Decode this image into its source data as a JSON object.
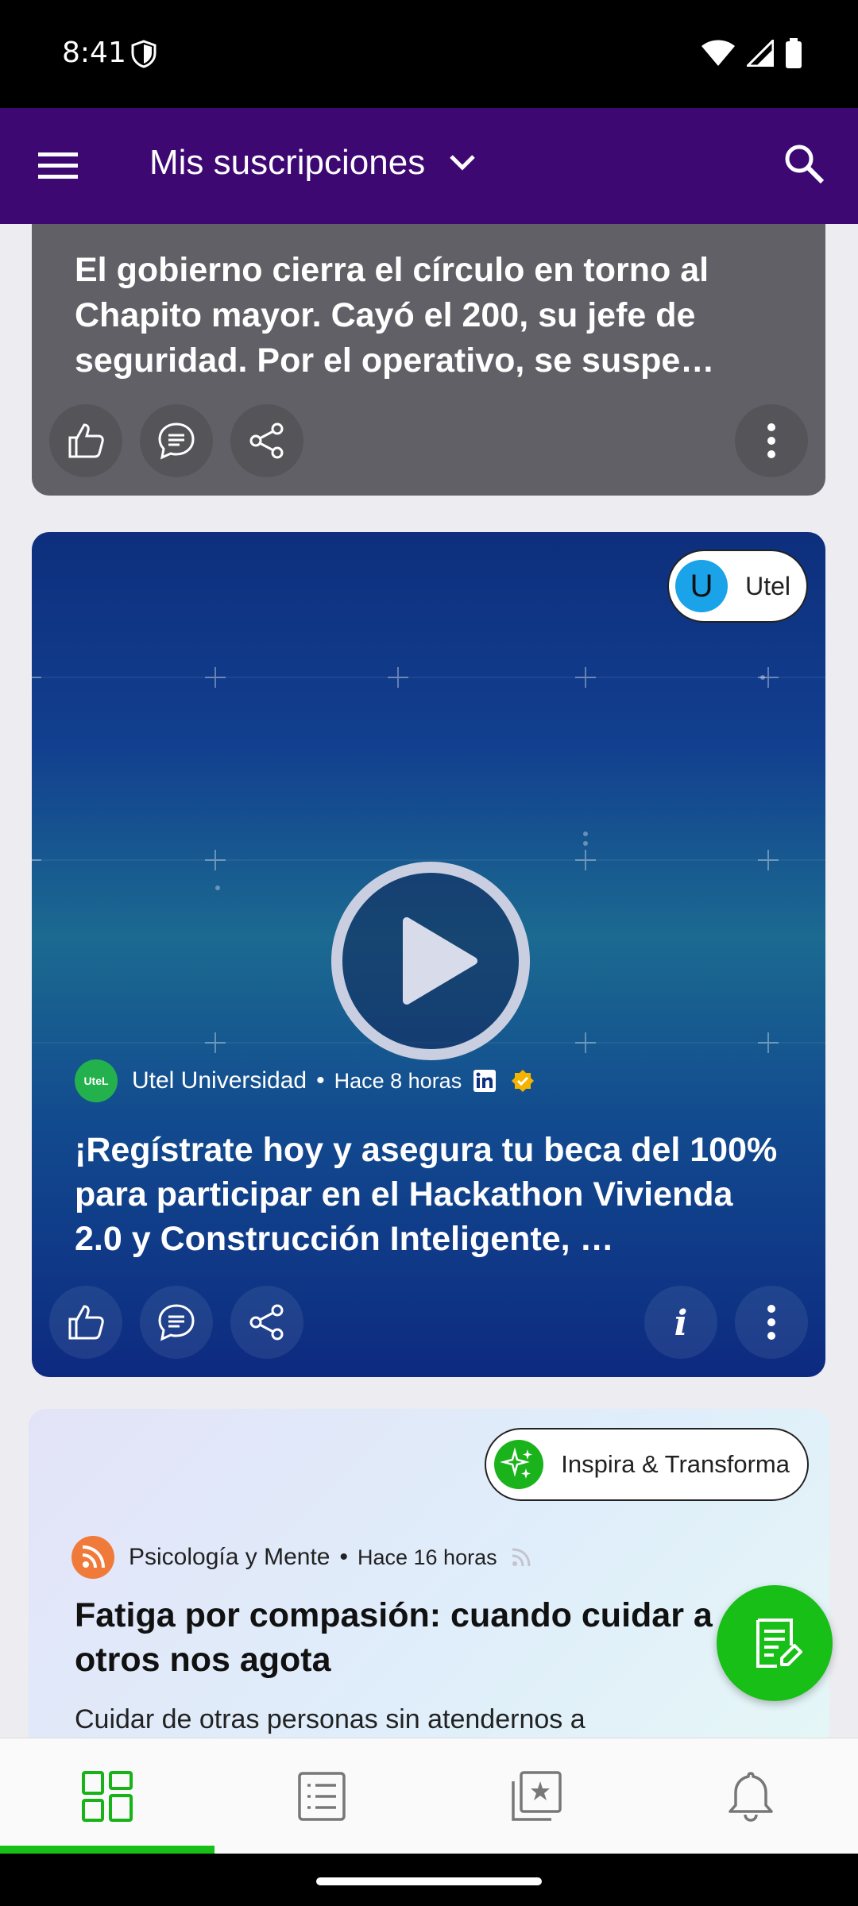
{
  "status": {
    "time": "8:41"
  },
  "appbar": {
    "title": "Mis suscripciones"
  },
  "cards": [
    {
      "headline": "El gobierno cierra el círculo en torno al Chapito mayor. Cayó el 200, su jefe de seguridad. Por el operativo,  se suspe…"
    },
    {
      "chip_label": "Utel",
      "chip_initial": "U",
      "source": "Utel Universidad",
      "source_logo_text": "UteL",
      "separator": "•",
      "time": "Hace 8 horas",
      "headline": "¡Regístrate hoy y asegura tu beca del 100% para participar en el Hackathon Vivienda 2.0 y Construcción Inteligente, …"
    },
    {
      "chip_label": "Inspira & Transforma",
      "source": "Psicología y Mente",
      "separator": "•",
      "time": "Hace 16 horas",
      "headline": "Fatiga por compasión: cuando cuidar a otros nos agota",
      "summary": "Cuidar de otras personas sin atendernos a"
    }
  ],
  "colors": {
    "appbar": "#3d0872",
    "accent": "#17bf17",
    "linkedin": "#0a66c2",
    "verified": "#f5b400"
  },
  "nav": {
    "active_index": 0,
    "items": [
      "grid-icon",
      "list-icon",
      "star-collection-icon",
      "bell-icon"
    ]
  }
}
